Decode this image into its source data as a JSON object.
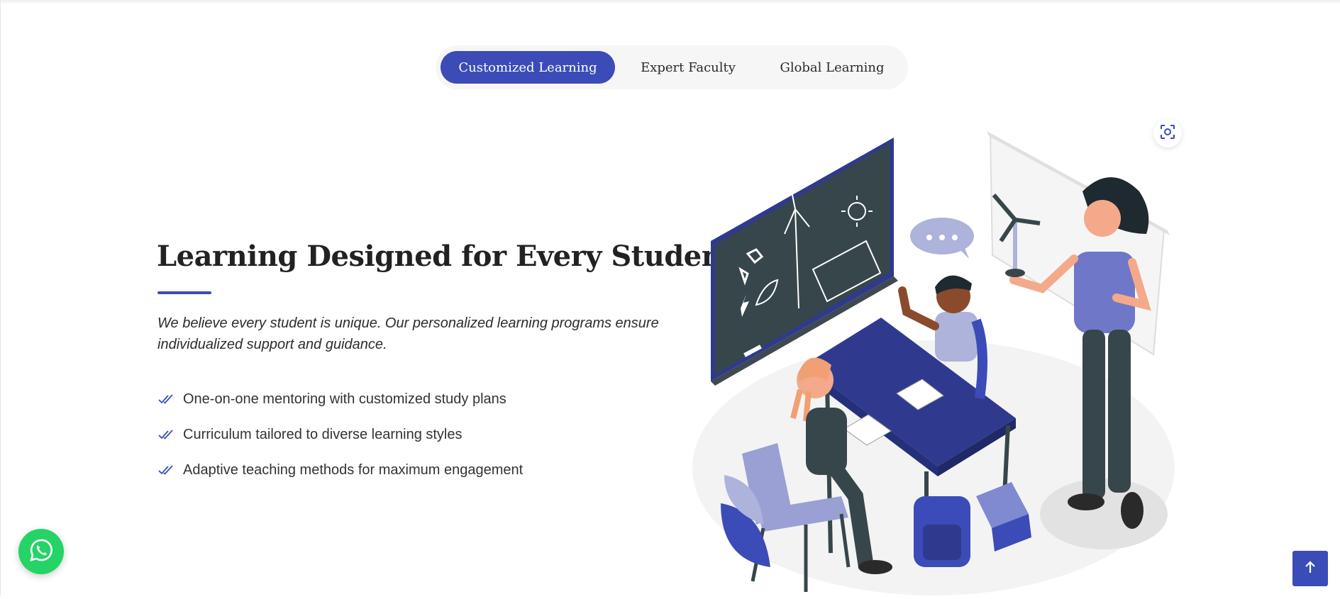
{
  "tabs": [
    {
      "label": "Customized Learning",
      "active": true
    },
    {
      "label": "Expert Faculty",
      "active": false
    },
    {
      "label": "Global Learning",
      "active": false
    }
  ],
  "section": {
    "title": "Learning Designed for Every Student",
    "description": "We believe every student is unique. Our personalized learning programs ensure individualized support and guidance.",
    "features": [
      "One-on-one mentoring with customized study plans",
      "Curriculum tailored to diverse learning styles",
      "Adaptive teaching methods for maximum engagement"
    ]
  },
  "icons": {
    "feature_bullet": "double-check-icon",
    "expand": "focus-expand-icon",
    "whatsapp": "whatsapp-icon",
    "scroll_top": "arrow-up-icon"
  },
  "colors": {
    "accent": "#3b4cb8",
    "whatsapp": "#25d366",
    "heading": "#222222"
  }
}
